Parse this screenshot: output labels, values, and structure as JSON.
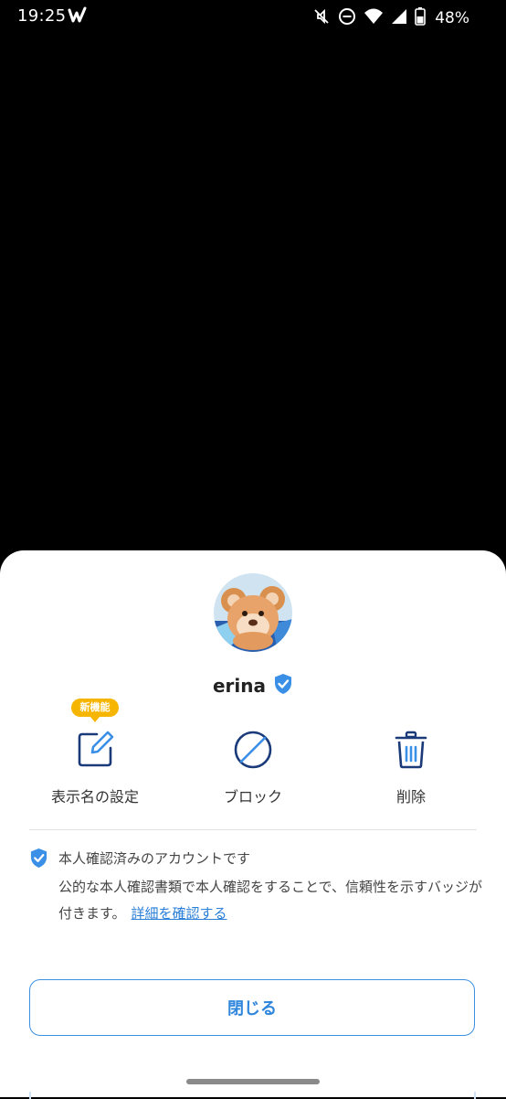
{
  "status_bar": {
    "time": "19:25",
    "battery": "48%",
    "icons": [
      "w-app-icon",
      "mute-icon",
      "dnd-icon",
      "wifi-icon",
      "signal-icon",
      "battery-icon"
    ]
  },
  "profile": {
    "name": "erina",
    "verified": true
  },
  "actions": [
    {
      "label": "表示名の設定",
      "icon": "edit-icon",
      "badge": "新機能"
    },
    {
      "label": "ブロック",
      "icon": "block-icon"
    },
    {
      "label": "削除",
      "icon": "trash-icon"
    }
  ],
  "verification_notice": {
    "title": "本人確認済みのアカウントです",
    "body": "公的な本人確認書類で本人確認をすることで、信頼性を示すバッジが付きます。",
    "link": "詳細を確認する"
  },
  "close_button": "閉じる",
  "colors": {
    "accent": "#2f86dc",
    "verified_badge": "#3a8fe6",
    "icon_dark": "#1a3a7a",
    "new_badge": "#f6b500"
  }
}
